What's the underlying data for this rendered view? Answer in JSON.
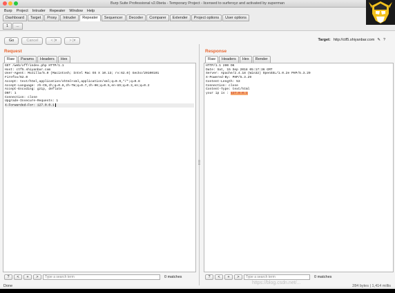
{
  "window": {
    "title": "Burp Suite Professional v2.0beta - Temporary Project - licensed to surferxyz and activated by superman"
  },
  "menu": [
    "Burp",
    "Project",
    "Intruder",
    "Repeater",
    "Window",
    "Help"
  ],
  "main_tabs": [
    "Dashboard",
    "Target",
    "Proxy",
    "Intruder",
    "Repeater",
    "Sequencer",
    "Decoder",
    "Comparer",
    "Extender",
    "Project options",
    "User options"
  ],
  "active_main_tab": "Repeater",
  "sub_tabs": [
    "1",
    "..."
  ],
  "toolbar": {
    "go": "Go",
    "cancel": "Cancel",
    "back": "< |▾",
    "forward": "> |▾"
  },
  "target": {
    "label": "Target:",
    "value": "http://ctf5.shiyanbar.com"
  },
  "request": {
    "title": "Request",
    "tabs": [
      "Raw",
      "Params",
      "Headers",
      "Hex"
    ],
    "lines": [
      "GET /web/xff/index.php HTTP/1.1",
      "Host: ctf5.shiyanbar.com",
      "User-Agent: Mozilla/5.0 (Macintosh; Intel Mac OS X 10.13; rv:62.0) Gecko/20100101",
      "Firefox/62.0",
      "Accept: text/html,application/xhtml+xml,application/xml;q=0.9,*/*;q=0.8",
      "Accept-Language: zh-CN,zh;q=0.8,zh-TW;q=0.7,zh-HK;q=0.5,en-US;q=0.3,en;q=0.2",
      "Accept-Encoding: gzip, deflate",
      "DNT: 1",
      "Connection: close",
      "Upgrade-Insecure-Requests: 1",
      "X-Forwarded-For: 127.0.0.1"
    ],
    "search_placeholder": "Type a search term",
    "matches": "0 matches"
  },
  "response": {
    "title": "Response",
    "tabs": [
      "Raw",
      "Headers",
      "Hex",
      "Render"
    ],
    "lines": [
      "HTTP/1.1 200 OK",
      "Date: Sat, 15 Sep 2018 05:17:36 GMT",
      "Server: Apache/2.4.18 (Win32) OpenSSL/1.0.2e PHP/5.3.29",
      "X-Powered-By: PHP/5.3.29",
      "Content-Length: 53",
      "Connection: close",
      "Content-Type: text/html",
      "",
      "your ip is :"
    ],
    "ip": "127.0.0.1",
    "search_placeholder": "Type a search term",
    "matches": "0 matches"
  },
  "status": {
    "left": "Done",
    "right": "284 bytes | 1,414 millis"
  },
  "watermark": "https://blog.csdn.net/..."
}
